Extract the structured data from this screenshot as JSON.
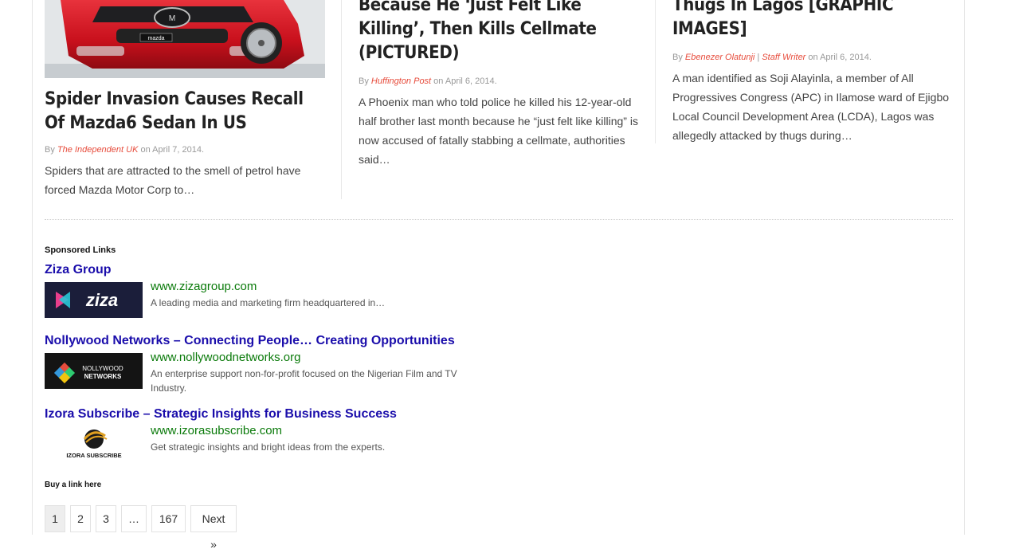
{
  "posts": [
    {
      "title": "Spider Invasion Causes Recall Of Mazda6 Sedan In US",
      "meta_prefix": "By ",
      "authors": [
        "The Independent UK"
      ],
      "meta_suffix": " on April 7, 2014.",
      "excerpt": "Spiders that are attracted to the smell of petrol have forced Mazda Motor Corp to…",
      "thumb_badge": "mazda"
    },
    {
      "title": "Because He ‘Just Felt Like Killing’, Then Kills Cellmate (PICTURED)",
      "meta_prefix": "By ",
      "authors": [
        "Huffington Post"
      ],
      "meta_suffix": " on April 6, 2014.",
      "excerpt": "A Phoenix man who told police he killed his 12-year-old half brother last month because he “just felt like killing” is now accused of fatally stabbing a cellmate, authorities said…"
    },
    {
      "title": "Thugs In Lagos [GRAPHIC IMAGES]",
      "meta_prefix": "By ",
      "authors": [
        "Ebenezer Olatunji",
        "Staff Writer"
      ],
      "author_sep": " | ",
      "meta_suffix": " on April 6, 2014.",
      "excerpt": "A man identified as Soji Alayinla, a member of All Progressives Congress (APC) in Ilamose ward of Ejigbo Local Council Development Area (LCDA), Lagos was allegedly attacked by thugs during…"
    }
  ],
  "sponsored": {
    "heading": "Sponsored Links",
    "ads": [
      {
        "title": "Ziza Group",
        "url": "www.zizagroup.com",
        "description": "A leading media and marketing firm headquartered in…",
        "logo_text": "ziza"
      },
      {
        "title": "Nollywood Networks – Connecting People… Creating Opportunities",
        "url": "www.nollywoodnetworks.org",
        "description": "An enterprise support non-for-profit focused on the Nigerian Film and TV Industry.",
        "logo_text_1": "NOLLYWOOD",
        "logo_text_2": "NETWORKS"
      },
      {
        "title": "Izora Subscribe – Strategic Insights for Business Success",
        "url": "www.izorasubscribe.com",
        "description": "Get strategic insights and bright ideas from the experts.",
        "logo_text": "IZORA SUBSCRIBE"
      }
    ],
    "buy_link": "Buy a link here"
  },
  "pagination": {
    "pages": [
      "1",
      "2",
      "3",
      "…",
      "167"
    ],
    "current": "1",
    "next": "Next »"
  },
  "colors": {
    "author_link": "#e74c3c",
    "ad_title": "#1a0dab",
    "ad_url": "#0a7a0a"
  }
}
